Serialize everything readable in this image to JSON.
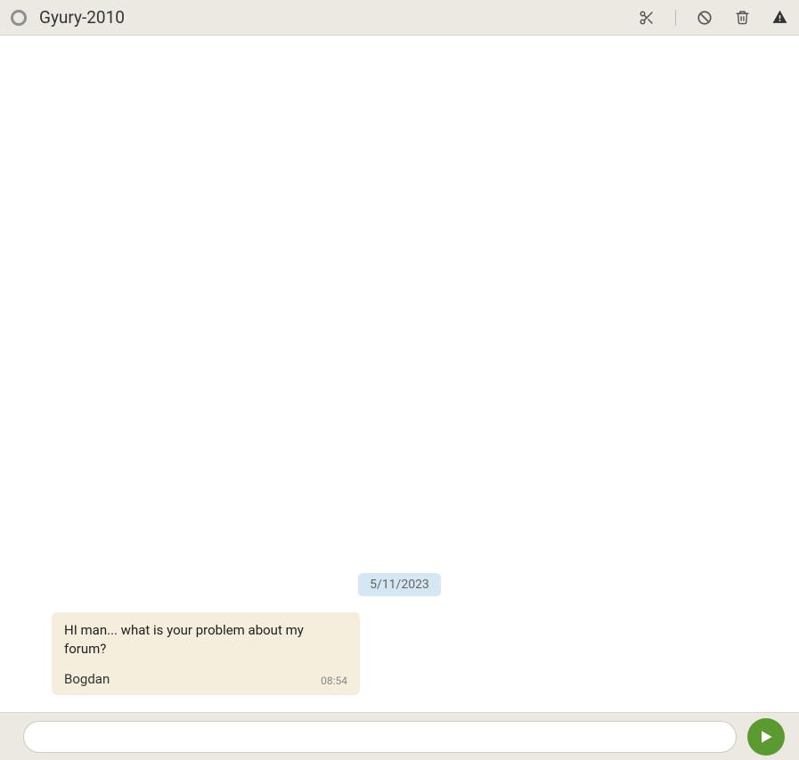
{
  "header": {
    "contact_name": "Gyury-2010"
  },
  "chat": {
    "date_label": "5/11/2023",
    "messages": [
      {
        "text": "HI man... what is your problem about my forum?",
        "author": "Bogdan",
        "time": "08:54"
      }
    ]
  },
  "composer": {
    "placeholder": "",
    "value": ""
  }
}
